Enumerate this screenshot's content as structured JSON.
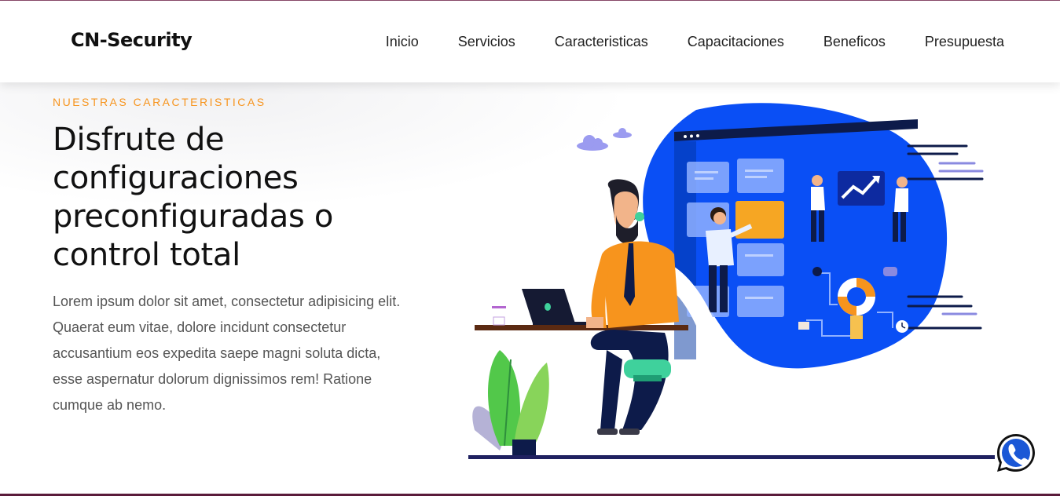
{
  "header": {
    "brand": "CN-Security",
    "nav": [
      {
        "label": "Inicio"
      },
      {
        "label": "Servicios"
      },
      {
        "label": "Caracteristicas"
      },
      {
        "label": "Capacitaciones"
      },
      {
        "label": "Beneficos"
      },
      {
        "label": "Presupuesta"
      }
    ]
  },
  "hero": {
    "eyebrow": "NUESTRAS CARACTERISTICAS",
    "headline": "Disfrute de configuraciones preconfiguradas o control total",
    "body": "Lorem ipsum dolor sit amet, consectetur adipisicing elit. Quaerat eum vitae, dolore incidunt consectetur accusantium eos expedita saepe magni soluta dicta, esse aspernatur dolorum dignissimos rem! Ratione cumque ab nemo."
  },
  "floating": {
    "icon": "whatsapp-icon"
  },
  "colors": {
    "accent": "#f7941d",
    "illustration_blue": "#0a4ff5",
    "whatsapp_blue": "#1a57d6"
  }
}
